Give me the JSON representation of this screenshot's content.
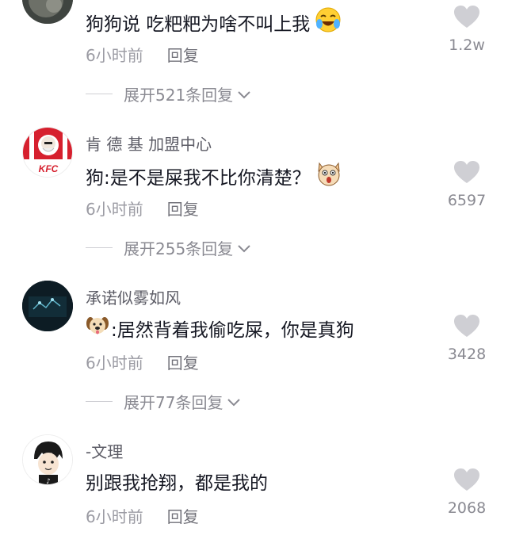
{
  "comments": [
    {
      "username": "",
      "text": "狗狗说  吃粑粑为啥不叫上我",
      "time": "6小时前",
      "reply_label": "回复",
      "likes": "1.2w",
      "expand_label": "展开521条回复"
    },
    {
      "username": "肯 德 基 加盟中心",
      "text": "狗:是不是屎我不比你清楚？",
      "time": "6小时前",
      "reply_label": "回复",
      "likes": "6597",
      "expand_label": "展开255条回复"
    },
    {
      "username": "承诺似雾如风",
      "text": ":居然背着我偷吃屎，你是真狗",
      "time": "6小时前",
      "reply_label": "回复",
      "likes": "3428",
      "expand_label": "展开77条回复"
    },
    {
      "username": "-文理",
      "text": "别跟我抢翔，都是我的",
      "time": "6小时前",
      "reply_label": "回复",
      "likes": "2068"
    }
  ],
  "avatars": {
    "kfc_logo_text": "KFC"
  },
  "colors": {
    "heart": "#cfcfd4",
    "kfc_red": "#d6202e"
  }
}
